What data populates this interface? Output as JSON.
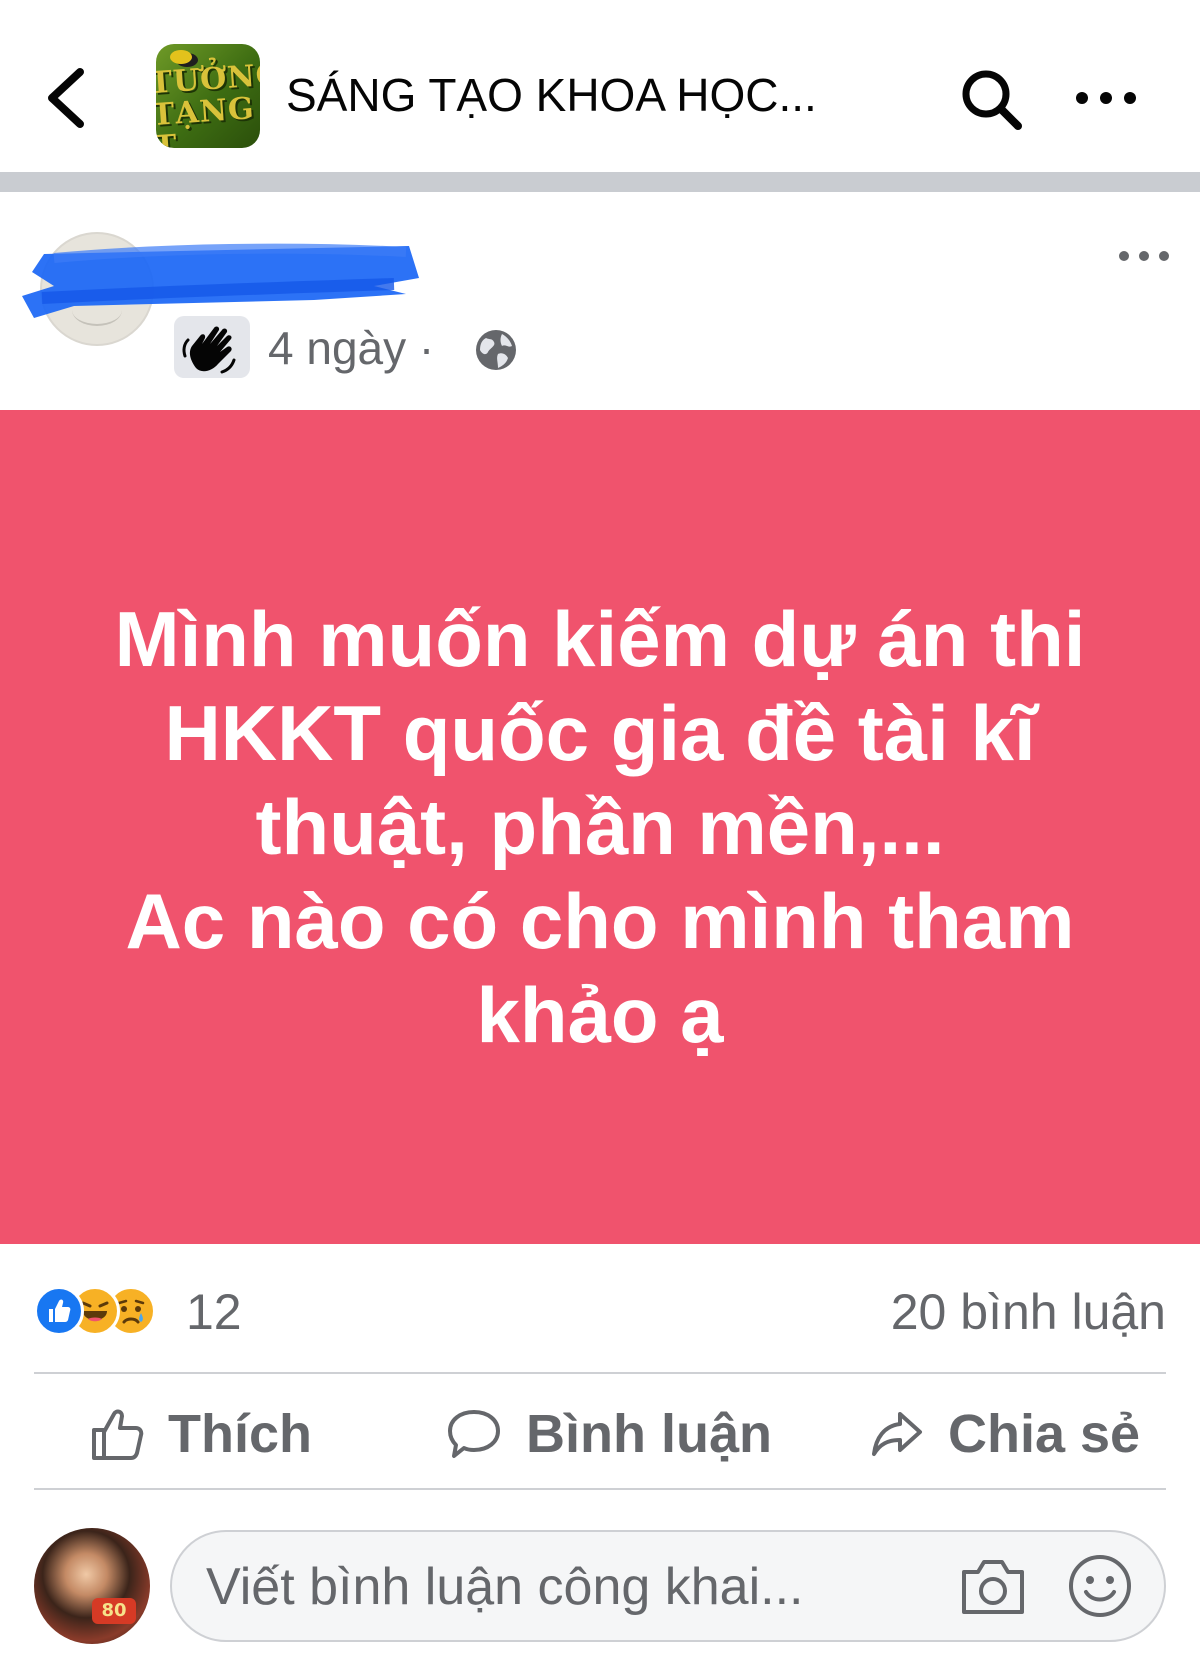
{
  "header": {
    "title": "SÁNG TẠO KHOA HỌC...",
    "logo_text": "TƯỞNG\nTẠNG T",
    "back_icon": "chevron-left-icon",
    "search_icon": "search-icon",
    "more_icon": "more-horizontal-icon"
  },
  "post": {
    "time": "4 ngày",
    "separator": "·",
    "privacy_icon": "globe-icon",
    "member_badge_icon": "waving-hand-icon",
    "background_color": "#f0536d",
    "text": "Mình muốn kiếm dự án thi\nHKKT quốc gia đề tài kĩ\nthuật, phần mền,...\nAc nào có cho mình tham\nkhảo ạ"
  },
  "stats": {
    "reaction_icons": [
      "like-icon",
      "haha-icon",
      "sad-icon"
    ],
    "reaction_count": "12",
    "comment_count": "20 bình luận"
  },
  "actions": {
    "like_label": "Thích",
    "comment_label": "Bình luận",
    "share_label": "Chia sẻ"
  },
  "composer": {
    "placeholder": "Viết bình luận công khai...",
    "avatar_badge": "80"
  },
  "colors": {
    "post_background": "#f0536d",
    "like_blue": "#1877f2",
    "reaction_yellow": "#f7b125",
    "secondary_text": "#65676b",
    "redaction_blue": "#1a66f5"
  }
}
